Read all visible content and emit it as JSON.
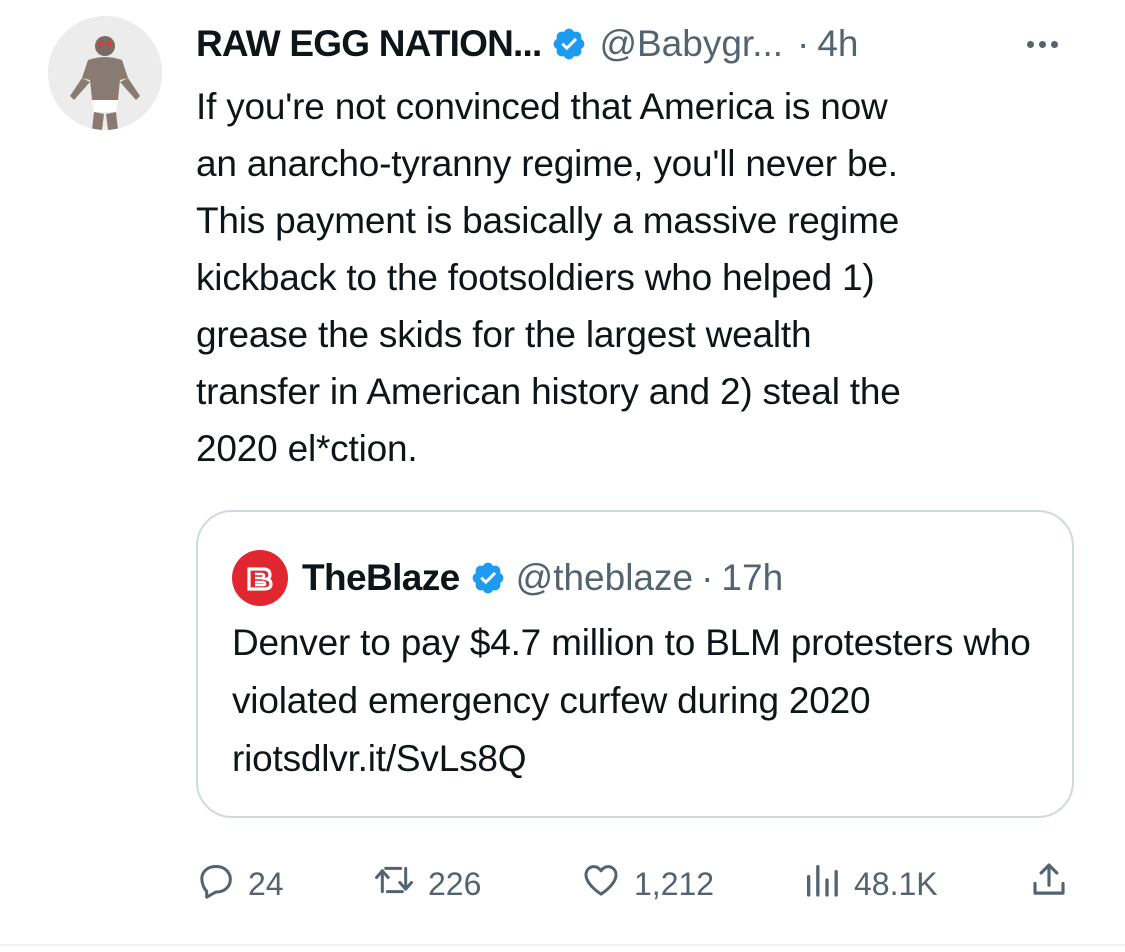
{
  "tweet": {
    "author_name": "RAW EGG NATION...",
    "handle": "@Babygr...",
    "separator": "·",
    "time": "4h",
    "text": "If you're not convinced that America is now\nan anarcho-tyranny regime, you'll never be.\nThis payment is basically a massive regime\nkickback to the footsoldiers who helped 1)\ngrease the skids for the largest wealth\ntransfer in American history and 2) steal the\n2020 el*ction."
  },
  "quoted": {
    "author_name": "TheBlaze",
    "handle": "@theblaze",
    "separator": "·",
    "time": "17h",
    "text": "Denver to pay $4.7 million to BLM protesters who violated emergency curfew during 2020 riotsdlvr.it/SvLs8Q"
  },
  "actions": {
    "replies": "24",
    "reposts": "226",
    "likes": "1,212",
    "views": "48.1K"
  },
  "icons": {
    "verified": "verified-badge-icon",
    "more": "more-options-icon",
    "reply": "reply-icon",
    "repost": "repost-icon",
    "like": "like-icon",
    "views": "views-icon",
    "share": "share-icon"
  },
  "colors": {
    "verified_blue": "#1d9bf0",
    "secondary_text": "#536471",
    "blaze_red": "#e0272f",
    "border": "#cfd9de"
  }
}
